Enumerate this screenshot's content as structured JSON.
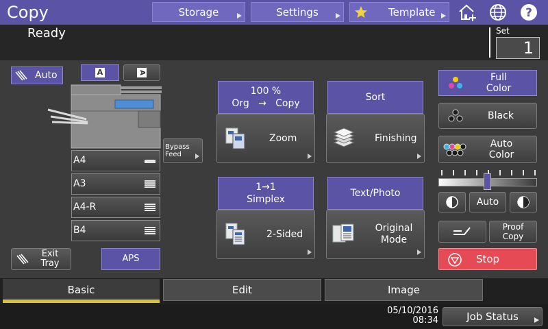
{
  "header": {
    "title": "Copy",
    "storage_label": "Storage",
    "settings_label": "Settings",
    "template_label": "Template",
    "icons": [
      "home-add-icon",
      "globe-icon",
      "help-icon"
    ],
    "accent_color": "#5b53a6"
  },
  "status": {
    "text": "Ready",
    "set_label": "Set",
    "set_value": "1"
  },
  "left_panel": {
    "auto_label": "Auto",
    "bypass_feed_label": "Bypass Feed",
    "trays": [
      {
        "label": "A4"
      },
      {
        "label": "A3"
      },
      {
        "label": "A4-R"
      },
      {
        "label": "B4"
      }
    ],
    "exit_tray_label": "Exit Tray",
    "aps_label": "APS"
  },
  "functions": {
    "zoom_header_line1": "100 %",
    "zoom_header_line2": "Org   →   Copy",
    "zoom_label": "Zoom",
    "sort_header": "Sort",
    "finishing_label": "Finishing",
    "duplex_header_line1": "1→1",
    "duplex_header_line2": "Simplex",
    "two_sided_label": "2-Sided",
    "mode_header": "Text/Photo",
    "original_mode_label": "Original Mode"
  },
  "color_panel": {
    "full_color_label": "Full Color",
    "black_label": "Black",
    "auto_color_label": "Auto Color",
    "density_auto_label": "Auto",
    "density_level": 0.5,
    "proof_copy_label": "Proof Copy",
    "stop_label": "Stop",
    "stop_color": "#e64a55"
  },
  "tabs": [
    {
      "label": "Basic",
      "active": true
    },
    {
      "label": "Edit",
      "active": false
    },
    {
      "label": "Image",
      "active": false
    }
  ],
  "footer": {
    "date": "05/10/2016",
    "time": "08:34",
    "job_status_label": "Job Status"
  }
}
